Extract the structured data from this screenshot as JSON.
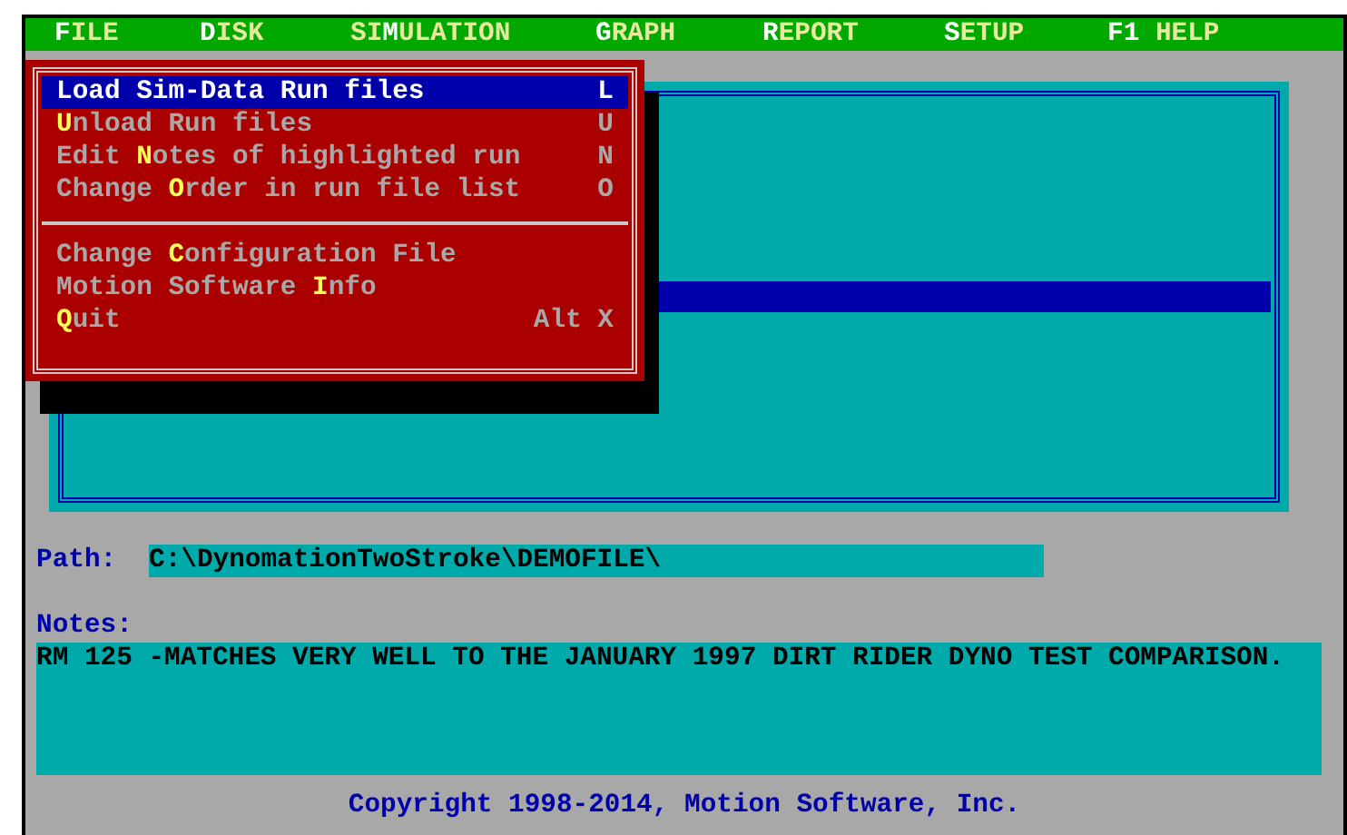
{
  "menu_bar": [
    {
      "key": "F",
      "after": "ILE"
    },
    {
      "key": "D",
      "after": "ISK"
    },
    {
      "before": "SI",
      "key": "M",
      "after": "ULATION"
    },
    {
      "key": "G",
      "after": "RAPH"
    },
    {
      "key": "R",
      "after": "EPORT"
    },
    {
      "key": "S",
      "after": "ETUP"
    },
    {
      "key": "F1",
      "after": " HELP"
    }
  ],
  "file_menu": [
    {
      "kind": "item",
      "before": "Load Sim-Data Run files",
      "shortcut": "L",
      "selected": true
    },
    {
      "kind": "item",
      "key": "U",
      "after": "nload Run files",
      "shortcut": "U",
      "selected": false
    },
    {
      "kind": "item",
      "before": "Edit ",
      "key": "N",
      "after": "otes of highlighted run",
      "shortcut": "N",
      "selected": false
    },
    {
      "kind": "item",
      "before": "Change ",
      "key": "O",
      "after": "rder in run file list",
      "shortcut": "O",
      "selected": false
    },
    {
      "kind": "separator"
    },
    {
      "kind": "item",
      "before": "Change ",
      "key": "C",
      "after": "onfiguration File",
      "selected": false
    },
    {
      "kind": "item",
      "before": "Motion Software ",
      "key": "I",
      "after": "nfo",
      "selected": false
    },
    {
      "kind": "item",
      "key": "Q",
      "after": "uit",
      "shortcut": "Alt X",
      "selected": false
    }
  ],
  "path": {
    "label": "Path:",
    "value": "C:\\DynomationTwoStroke\\DEMOFILE\\"
  },
  "notes": {
    "label": "Notes:",
    "value": "RM 125 -MATCHES VERY WELL TO THE JANUARY 1997 DIRT RIDER DYNO TEST COMPARISON."
  },
  "copyright": "Copyright 1998-2014, Motion Software, Inc."
}
